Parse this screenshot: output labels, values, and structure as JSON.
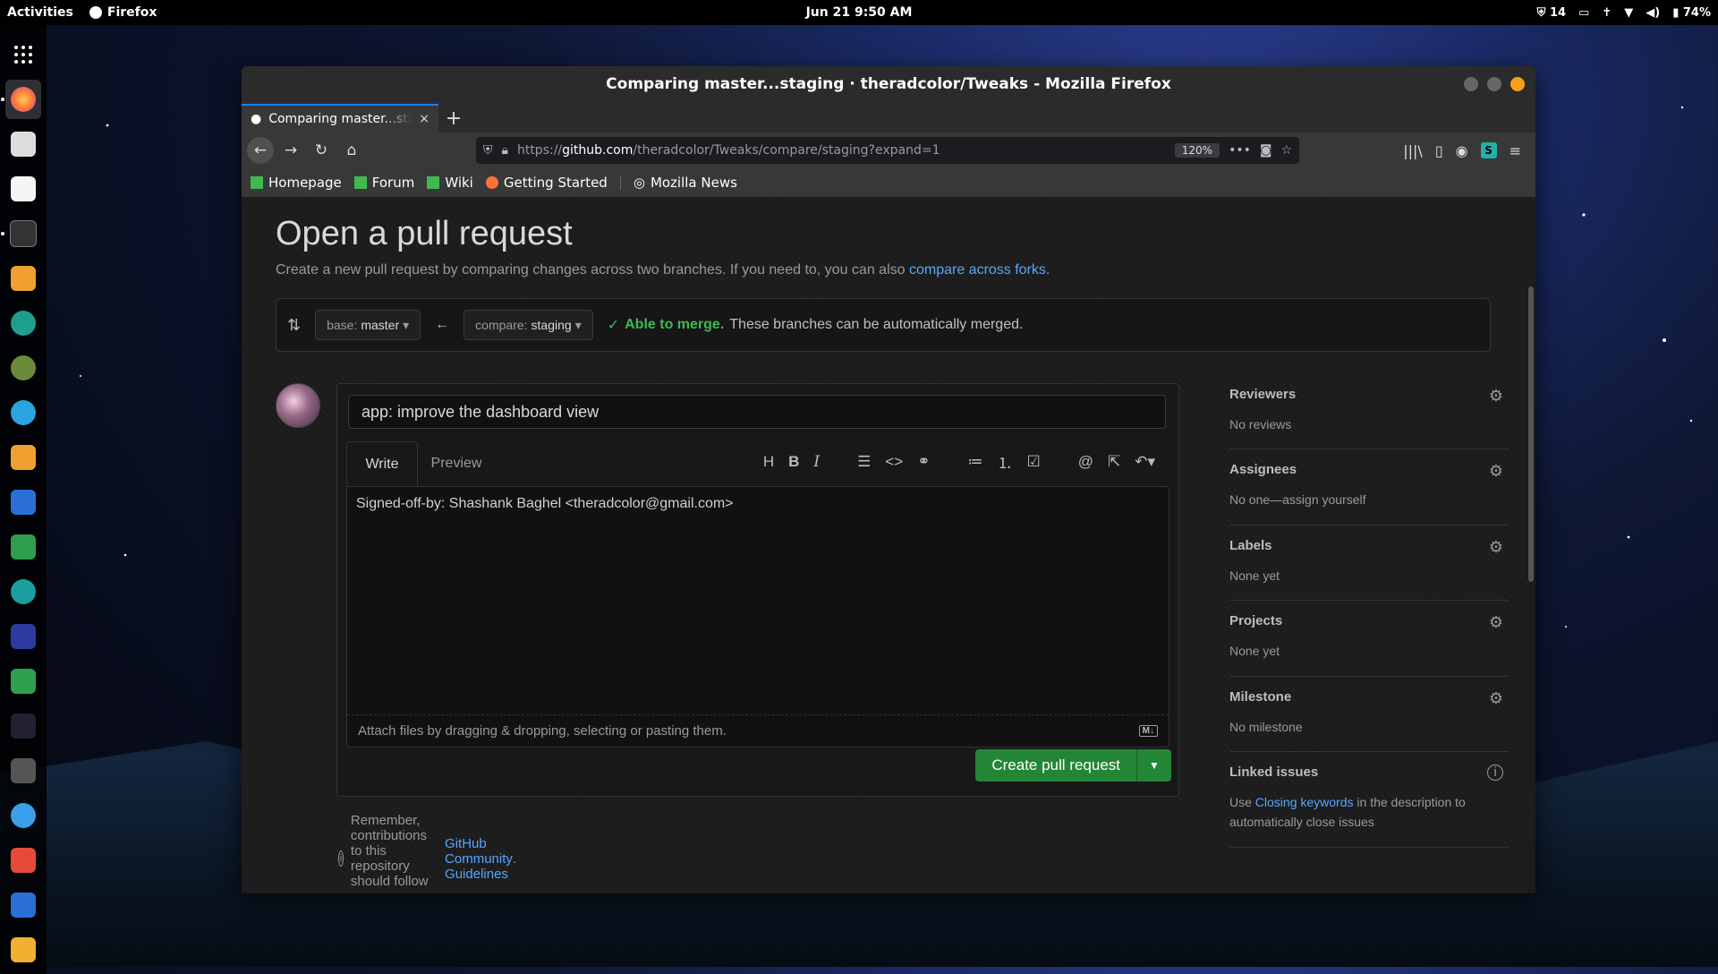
{
  "topbar": {
    "activities": "Activities",
    "app": "Firefox",
    "datetime": "Jun 21  9:50 AM",
    "shield_count": "14",
    "battery": "74%"
  },
  "dock": {
    "items": [
      "firefox",
      "files",
      "text-editor",
      "terminal",
      "downloader",
      "settings",
      "gimp",
      "telegram",
      "download",
      "docs",
      "monitor",
      "brush",
      "dots",
      "extension",
      "graph",
      "calculator",
      "weather",
      "calendar",
      "mail",
      "camera"
    ]
  },
  "window": {
    "title": "Comparing master...staging · theradcolor/Tweaks - Mozilla Firefox"
  },
  "tab": {
    "title": "Comparing master...staging",
    "close": "×",
    "new_tab": "+"
  },
  "urlbar": {
    "scheme": "https://",
    "host": "github.com",
    "path": "/theradcolor/Tweaks/compare/staging?expand=1",
    "zoom": "120%"
  },
  "bookmarks": [
    {
      "label": "Homepage",
      "icon": "github-green-icon"
    },
    {
      "label": "Forum",
      "icon": "github-green-icon"
    },
    {
      "label": "Wiki",
      "icon": "github-green-icon"
    },
    {
      "label": "Getting Started",
      "icon": "firefox-icon"
    },
    {
      "label": "Mozilla News",
      "icon": "globe-icon"
    }
  ],
  "page": {
    "heading": "Open a pull request",
    "subtitle_text": "Create a new pull request by comparing changes across two branches. If you need to, you can also",
    "subtitle_link": "compare across forks",
    "subtitle_end": ".",
    "base_label": "base:",
    "base_value": "master",
    "compare_label": "compare:",
    "compare_value": "staging",
    "merge_ok": "Able to merge.",
    "merge_text": "These branches can be automatically merged.",
    "pr_title": "app: improve the dashboard view",
    "tab_write": "Write",
    "tab_preview": "Preview",
    "body_text": "Signed-off-by: Shashank Baghel <theradcolor@gmail.com>",
    "attach_text": "Attach files by dragging & dropping, selecting or pasting them.",
    "md_badge": "M↓",
    "create_button": "Create pull request",
    "reminder_text": "Remember, contributions to this repository should follow our",
    "reminder_link": "GitHub Community Guidelines",
    "reminder_end": "."
  },
  "sidebar": [
    {
      "heading": "Reviewers",
      "value": "No reviews"
    },
    {
      "heading": "Assignees",
      "value": "No one—assign yourself"
    },
    {
      "heading": "Labels",
      "value": "None yet"
    },
    {
      "heading": "Projects",
      "value": "None yet"
    },
    {
      "heading": "Milestone",
      "value": "No milestone"
    }
  ],
  "linked_issues": {
    "heading": "Linked issues",
    "pre": "Use",
    "link": "Closing keywords",
    "post": "in the description to automatically close issues"
  },
  "colors": {
    "accent_green": "#238636",
    "link_blue": "#58a6ff",
    "tab_accent": "#0a84ff"
  }
}
